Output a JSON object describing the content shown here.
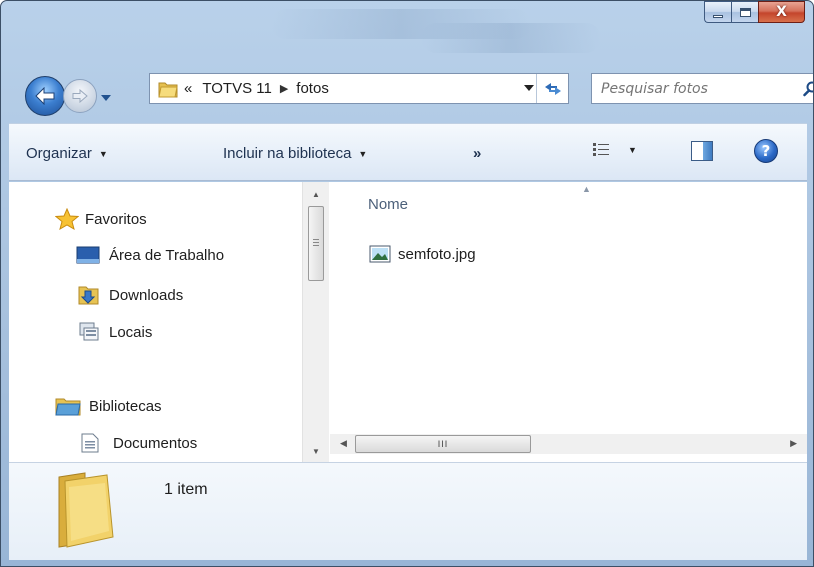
{
  "window": {
    "caption_buttons": {
      "minimize": "minimize",
      "maximize": "maximize",
      "close": "X"
    }
  },
  "navigation": {
    "address": {
      "prefix": "«",
      "crumbs": [
        "TOTVS 11",
        "fotos"
      ]
    },
    "search": {
      "placeholder": "Pesquisar fotos"
    }
  },
  "toolbar": {
    "organize_label": "Organizar",
    "library_label": "Incluir na biblioteca",
    "more_label": "»",
    "help_label": "?"
  },
  "nav_pane": {
    "items": [
      {
        "label": "Favoritos",
        "icon": "star-icon"
      },
      {
        "label": "Área de Trabalho",
        "icon": "desktop-icon"
      },
      {
        "label": "Downloads",
        "icon": "downloads-folder-icon"
      },
      {
        "label": "Locais",
        "icon": "recent-places-icon"
      },
      {
        "label": "Bibliotecas",
        "icon": "libraries-icon"
      },
      {
        "label": "Documentos",
        "icon": "document-icon"
      }
    ]
  },
  "file_pane": {
    "column_header": "Nome",
    "files": [
      {
        "name": "semfoto.jpg",
        "icon": "image-file-icon"
      }
    ],
    "hscroll_grip": "III"
  },
  "details": {
    "item_count": "1 item"
  },
  "colors": {
    "frame": "#a6c0dd",
    "toolbar": "#e8f0f9",
    "accent": "#2a68c6",
    "close": "#c4452c"
  }
}
